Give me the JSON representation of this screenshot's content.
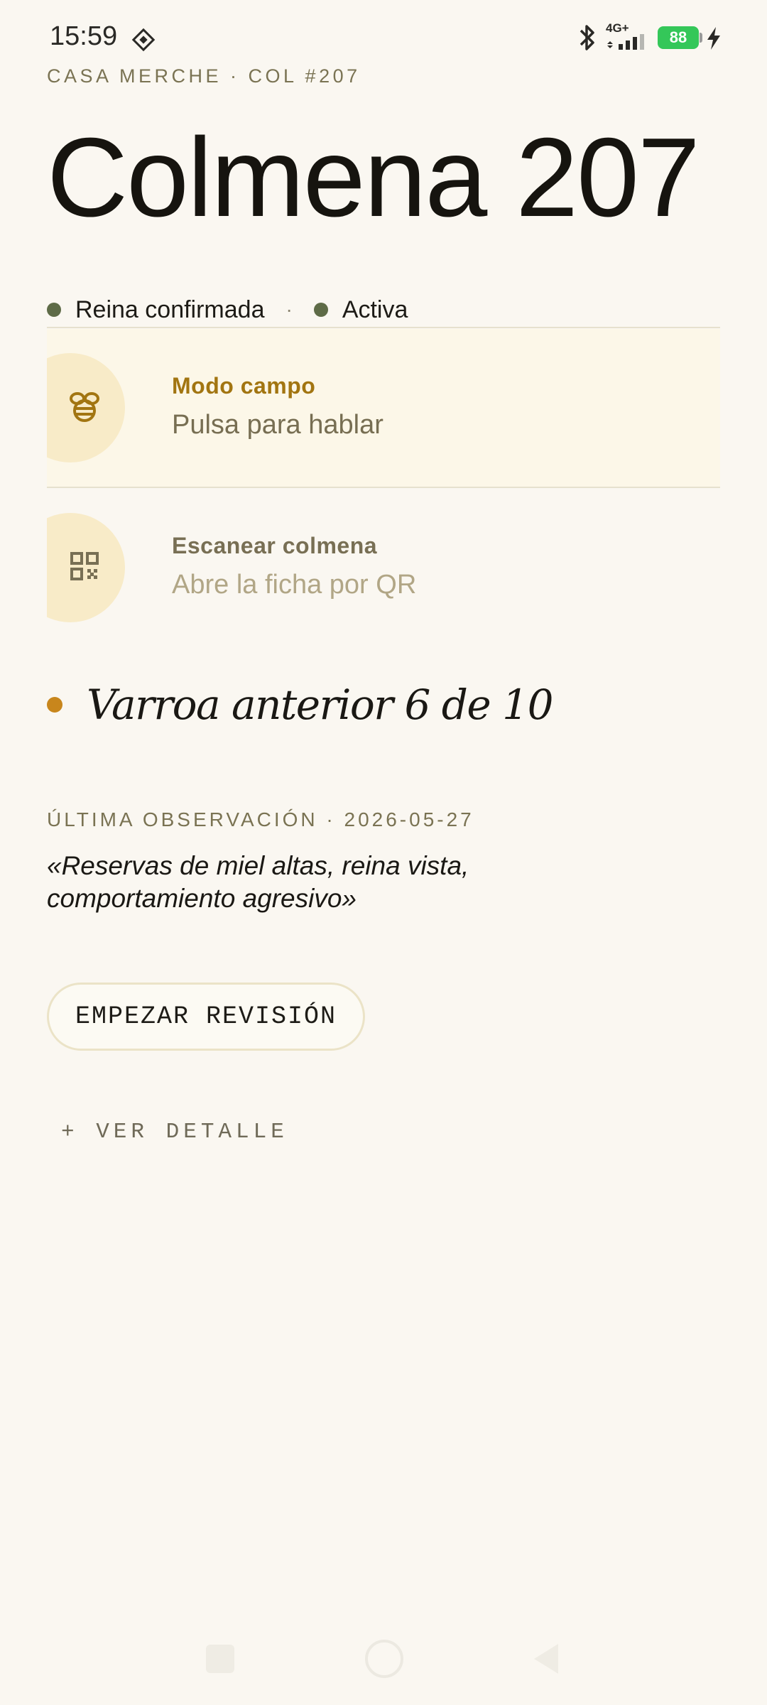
{
  "status_bar": {
    "time": "15:59",
    "network": "4G+",
    "battery": "88"
  },
  "hive": {
    "eyebrow": "CASA MERCHE · COL #207",
    "title": "Colmena 207",
    "status": [
      "Reina confirmada",
      "Activa"
    ],
    "status_separator": "·"
  },
  "cards": {
    "field_mode": {
      "label": "Modo campo",
      "sub": "Pulsa para hablar",
      "icon": "bee-icon"
    },
    "scan": {
      "label": "Escanear colmena",
      "sub": "Abre la ficha por QR",
      "icon": "qr-code-icon"
    }
  },
  "varroa": {
    "text": "Varroa anterior 6 de 10",
    "color": "#c8861c"
  },
  "observation": {
    "label": "ÚLTIMA OBSERVACIÓN · 2026-05-27",
    "quote": "«Reservas de miel altas, reina vista, comportamiento agresivo»"
  },
  "actions": {
    "start_review": "EMPEZAR REVISIÓN",
    "see_detail": "+ VER DETALLE"
  },
  "colors": {
    "background": "#faf7f1",
    "accent_gold": "#a27511",
    "status_green": "#5e6b47",
    "battery_green": "#34c759"
  }
}
